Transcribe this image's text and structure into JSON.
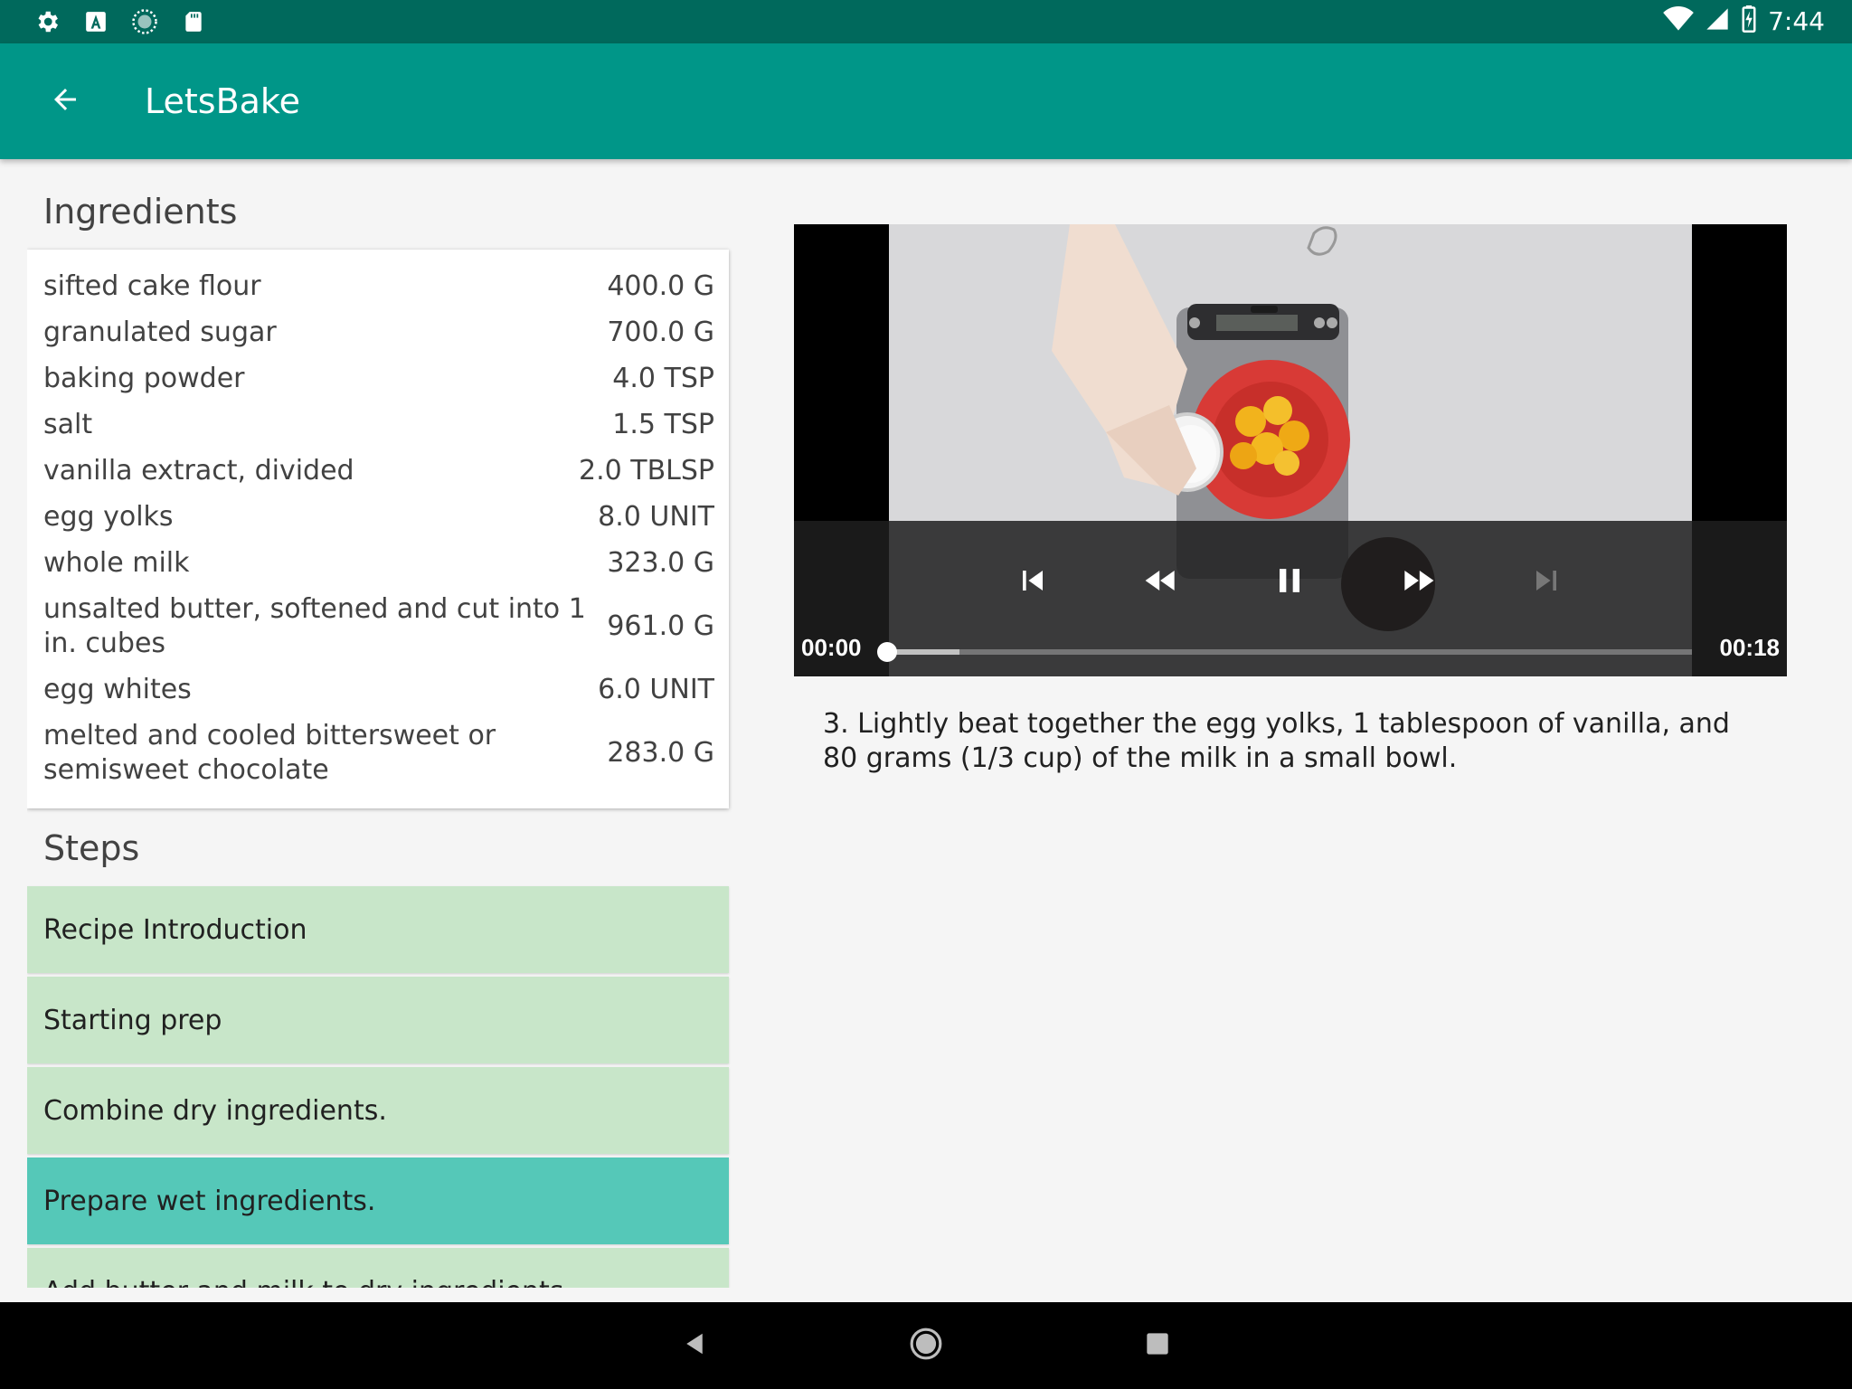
{
  "status_bar": {
    "time": "7:44",
    "left_icons": [
      "settings-icon",
      "a-icon",
      "sync-icon",
      "sd-card-icon"
    ],
    "right_icons": [
      "wifi-icon",
      "signal-icon",
      "battery-charging-icon"
    ]
  },
  "app_bar": {
    "title": "LetsBake",
    "back_icon": "arrow-back-icon"
  },
  "ingredients": {
    "heading": "Ingredients",
    "items": [
      {
        "name": "sifted cake flour",
        "qty": "400.0 G"
      },
      {
        "name": "granulated sugar",
        "qty": "700.0 G"
      },
      {
        "name": "baking powder",
        "qty": "4.0 TSP"
      },
      {
        "name": "salt",
        "qty": "1.5 TSP"
      },
      {
        "name": "vanilla extract, divided",
        "qty": "2.0 TBLSP"
      },
      {
        "name": "egg yolks",
        "qty": "8.0 UNIT"
      },
      {
        "name": "whole milk",
        "qty": "323.0 G"
      },
      {
        "name": "unsalted butter, softened and cut into 1 in. cubes",
        "qty": "961.0 G"
      },
      {
        "name": "egg whites",
        "qty": "6.0 UNIT"
      },
      {
        "name": "melted and cooled bittersweet or semisweet chocolate",
        "qty": "283.0 G"
      }
    ]
  },
  "steps": {
    "heading": "Steps",
    "items": [
      {
        "label": "Recipe Introduction"
      },
      {
        "label": "Starting prep"
      },
      {
        "label": "Combine dry ingredients."
      },
      {
        "label": "Prepare wet ingredients."
      },
      {
        "label": "Add butter and milk to dry ingredients."
      }
    ],
    "selected_index": 3
  },
  "player": {
    "position": "00:00",
    "duration": "00:18",
    "progress": 0.0,
    "buffered": 0.09,
    "state": "playing",
    "controls": [
      "skip-previous-icon",
      "rewind-icon",
      "pause-icon",
      "fast-forward-icon",
      "skip-next-icon"
    ]
  },
  "step_description": "3. Lightly beat together the egg yolks, 1 tablespoon of vanilla, and 80 grams (1/3 cup) of the milk in a small bowl.",
  "colors": {
    "status_bar": "#00695c",
    "app_bar": "#009688",
    "step_bg": "#c8e6c9",
    "step_selected": "#55c8b8"
  },
  "nav_bar": {
    "icons": [
      "back-triangle-icon",
      "home-circle-icon",
      "recents-square-icon"
    ]
  }
}
